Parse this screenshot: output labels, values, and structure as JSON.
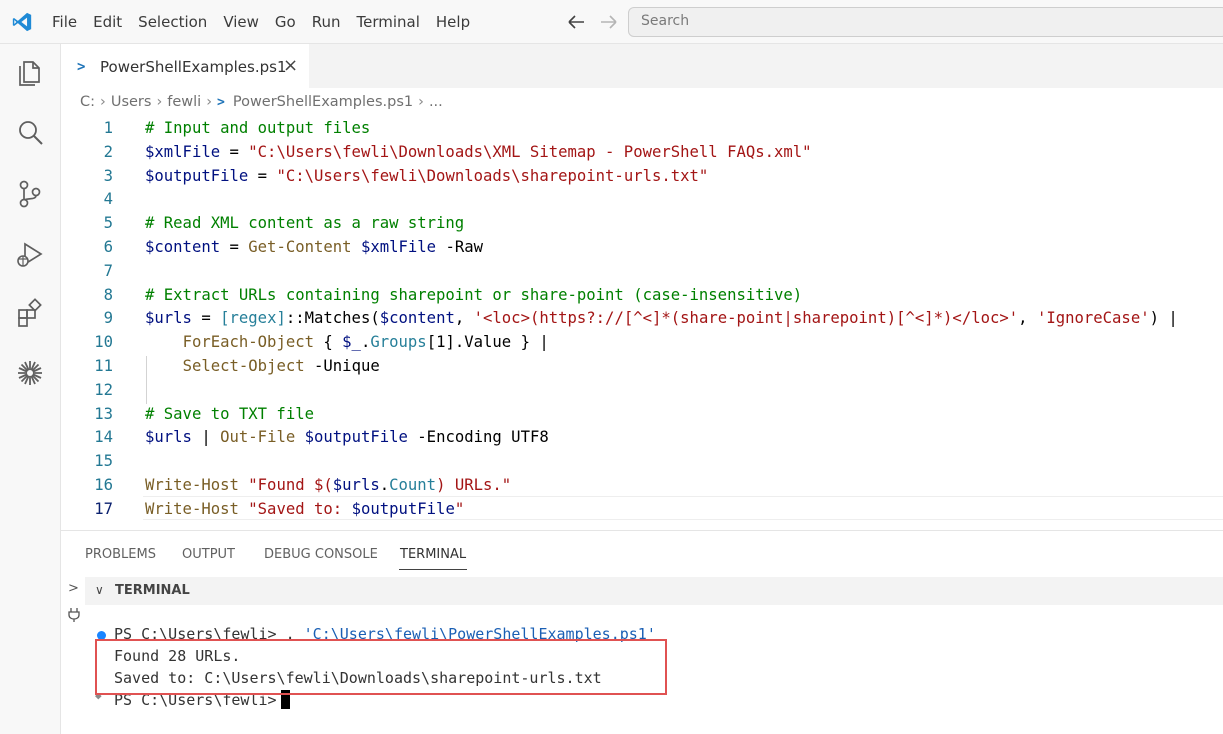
{
  "menu": [
    "File",
    "Edit",
    "Selection",
    "View",
    "Go",
    "Run",
    "Terminal",
    "Help"
  ],
  "search": {
    "placeholder": "Search"
  },
  "tab": {
    "label": "PowerShellExamples.ps1",
    "close": "×",
    "icon": ">"
  },
  "breadcrumb": {
    "items": [
      "C:",
      "Users",
      "fewli",
      "PowerShellExamples.ps1",
      "..."
    ]
  },
  "editor": {
    "line_numbers": [
      "1",
      "2",
      "3",
      "4",
      "5",
      "6",
      "7",
      "8",
      "9",
      "10",
      "11",
      "12",
      "13",
      "14",
      "15",
      "16",
      "17"
    ],
    "lines": [
      [
        {
          "t": "# Input and output files",
          "c": "com"
        }
      ],
      [
        {
          "t": "$xmlFile",
          "c": "var"
        },
        {
          "t": " = ",
          "c": "par"
        },
        {
          "t": "\"C:\\Users\\fewli\\Downloads\\XML Sitemap - PowerShell FAQs.xml\"",
          "c": "str"
        }
      ],
      [
        {
          "t": "$outputFile",
          "c": "var"
        },
        {
          "t": " = ",
          "c": "par"
        },
        {
          "t": "\"C:\\Users\\fewli\\Downloads\\sharepoint-urls.txt\"",
          "c": "str"
        }
      ],
      [],
      [
        {
          "t": "# Read XML content as a raw string",
          "c": "com"
        }
      ],
      [
        {
          "t": "$content",
          "c": "var"
        },
        {
          "t": " = ",
          "c": "par"
        },
        {
          "t": "Get-Content",
          "c": "cmd"
        },
        {
          "t": " ",
          "c": "par"
        },
        {
          "t": "$xmlFile",
          "c": "var"
        },
        {
          "t": " -Raw",
          "c": "par"
        }
      ],
      [],
      [
        {
          "t": "# Extract URLs containing sharepoint or share-point (case-insensitive)",
          "c": "com"
        }
      ],
      [
        {
          "t": "$urls",
          "c": "var"
        },
        {
          "t": " = ",
          "c": "par"
        },
        {
          "t": "[regex]",
          "c": "type"
        },
        {
          "t": "::Matches(",
          "c": "par"
        },
        {
          "t": "$content",
          "c": "var"
        },
        {
          "t": ", ",
          "c": "par"
        },
        {
          "t": "'<loc>(https?://[^<]*(share-point|sharepoint)[^<]*)</loc>'",
          "c": "str"
        },
        {
          "t": ", ",
          "c": "par"
        },
        {
          "t": "'IgnoreCase'",
          "c": "str"
        },
        {
          "t": ") |",
          "c": "par"
        }
      ],
      [
        {
          "t": "    ",
          "c": "par"
        },
        {
          "t": "ForEach-Object",
          "c": "cmd"
        },
        {
          "t": " { ",
          "c": "par"
        },
        {
          "t": "$_",
          "c": "var"
        },
        {
          "t": ".",
          "c": "par"
        },
        {
          "t": "Groups",
          "c": "type"
        },
        {
          "t": "[1].",
          "c": "par"
        },
        {
          "t": "Value",
          "c": "par"
        },
        {
          "t": " } |",
          "c": "par"
        }
      ],
      [
        {
          "t": "    ",
          "c": "par"
        },
        {
          "t": "Select-Object",
          "c": "cmd"
        },
        {
          "t": " -Unique",
          "c": "par"
        }
      ],
      [],
      [
        {
          "t": "# Save to TXT file",
          "c": "com"
        }
      ],
      [
        {
          "t": "$urls",
          "c": "var"
        },
        {
          "t": " | ",
          "c": "par"
        },
        {
          "t": "Out-File",
          "c": "cmd"
        },
        {
          "t": " ",
          "c": "par"
        },
        {
          "t": "$outputFile",
          "c": "var"
        },
        {
          "t": " -Encoding UTF8",
          "c": "par"
        }
      ],
      [],
      [
        {
          "t": "Write-Host",
          "c": "cmd"
        },
        {
          "t": " ",
          "c": "par"
        },
        {
          "t": "\"Found $(",
          "c": "str"
        },
        {
          "t": "$urls",
          "c": "var"
        },
        {
          "t": ".",
          "c": "par"
        },
        {
          "t": "Count",
          "c": "type"
        },
        {
          "t": ") URLs.\"",
          "c": "str"
        }
      ],
      [
        {
          "t": "Write-Host",
          "c": "cmd"
        },
        {
          "t": " ",
          "c": "par"
        },
        {
          "t": "\"Saved to: ",
          "c": "str"
        },
        {
          "t": "$outputFile",
          "c": "var"
        },
        {
          "t": "\"",
          "c": "str"
        }
      ]
    ]
  },
  "panel": {
    "tabs": [
      "PROBLEMS",
      "OUTPUT",
      "DEBUG CONSOLE",
      "TERMINAL"
    ],
    "active_tab": "TERMINAL",
    "section_title": "TERMINAL"
  },
  "terminal": {
    "prompt": "PS C:\\Users\\fewli>",
    "command_prefix": " . ",
    "command_path": "'C:\\Users\\fewli\\PowerShellExamples.ps1'",
    "output_line_1": "Found 28 URLs.",
    "output_line_2": "Saved to: C:\\Users\\fewli\\Downloads\\sharepoint-urls.txt",
    "prompt_2": "PS C:\\Users\\fewli>"
  },
  "colors": {
    "accent": "#007acc",
    "highlight_box": "#e05252",
    "comment": "#008000",
    "variable": "#001080",
    "string": "#a31515",
    "command": "#795e26",
    "type": "#267f99"
  }
}
